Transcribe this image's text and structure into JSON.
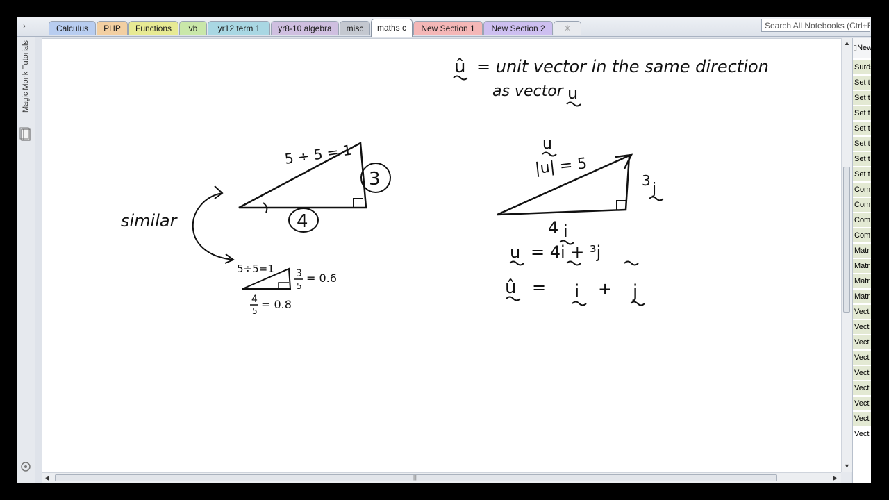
{
  "tabs": [
    {
      "label": "Calculus",
      "color": "#b8cdf0"
    },
    {
      "label": "PHP",
      "color": "#f2cfa2"
    },
    {
      "label": "Functions",
      "color": "#e7ea94"
    },
    {
      "label": "vb",
      "color": "#c9e7a9"
    },
    {
      "label": "yr12 term 1",
      "color": "#a9d7e3"
    },
    {
      "label": "yr8-10 algebra",
      "color": "#cfbfe0"
    },
    {
      "label": "misc",
      "color": "#c4c8d0"
    },
    {
      "label": "maths c",
      "color": "#ffffff",
      "active": true
    },
    {
      "label": "New Section 1",
      "color": "#f4b7b7"
    },
    {
      "label": "New Section 2",
      "color": "#cdbff0"
    }
  ],
  "new_tab_icon": "plus-tab-icon",
  "search": {
    "placeholder": "Search All Notebooks (Ctrl+E)"
  },
  "nav": {
    "notebook_label": "Magic Monk Tutorials"
  },
  "page_list": {
    "new_page_label": "New Page",
    "items": [
      "Surds",
      "Set t",
      "Set t",
      "Set t",
      "Set t",
      "Set t",
      "Set t",
      "Set t",
      "Com",
      "Com",
      "Com",
      "Com",
      "Matr",
      "Matr",
      "Matr",
      "Matr",
      "Vect",
      "Vect",
      "Vect",
      "Vect",
      "Vect",
      "Vect",
      "Vect",
      "Vect",
      "Vect"
    ],
    "selected_index": 24
  },
  "ink": {
    "definition_line1": "= unit vector in the same direction",
    "definition_line2": "as vector",
    "u": "u",
    "u_hat": "û",
    "similar": "similar",
    "big_hyp": "5 ÷ 5 = 1",
    "big_opp": "3",
    "big_adj": "4",
    "small_hyp": "5÷5=1",
    "small_opp": "= 0.6",
    "small_adj": "= 0.8",
    "frac_num_3": "3",
    "frac_num_4": "4",
    "frac_den": "5",
    "mag": "|u| = 5",
    "side_j": "3",
    "side_i": "4",
    "i": "i",
    "j": "j",
    "eq1_rhs": "= 4i + ³j",
    "eq2": "=",
    "plus": "+"
  }
}
